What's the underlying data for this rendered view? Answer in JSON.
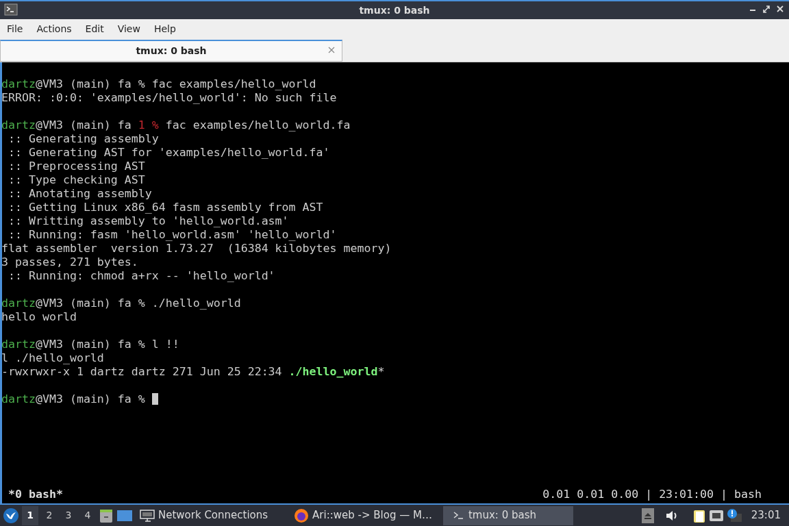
{
  "window": {
    "title": "tmux: 0 bash"
  },
  "menu": [
    "File",
    "Actions",
    "Edit",
    "View",
    "Help"
  ],
  "tabs": [
    {
      "label": "tmux: 0 bash",
      "selected": true
    }
  ],
  "terminal": {
    "blocks": [
      [
        [
          {
            "text": "dartz",
            "kind": "user"
          },
          {
            "text": "@VM3 (main) fa % fac examples/hello_world",
            "kind": "plain"
          }
        ],
        [
          {
            "text": "ERROR: :0:0: 'examples/hello_world': No such file",
            "kind": "plain"
          }
        ]
      ],
      [
        [
          {
            "text": "dartz",
            "kind": "user"
          },
          {
            "text": "@VM3 (main) fa ",
            "kind": "plain"
          },
          {
            "text": "1 %",
            "kind": "error"
          },
          {
            "text": " fac examples/hello_world.fa",
            "kind": "plain"
          }
        ],
        [
          {
            "text": " :: Generating assembly",
            "kind": "plain"
          }
        ],
        [
          {
            "text": " :: Generating AST for 'examples/hello_world.fa'",
            "kind": "plain"
          }
        ],
        [
          {
            "text": " :: Preprocessing AST",
            "kind": "plain"
          }
        ],
        [
          {
            "text": " :: Type checking AST",
            "kind": "plain"
          }
        ],
        [
          {
            "text": " :: Anotating assembly",
            "kind": "plain"
          }
        ],
        [
          {
            "text": " :: Getting Linux x86_64 fasm assembly from AST",
            "kind": "plain"
          }
        ],
        [
          {
            "text": " :: Writting assembly to 'hello_world.asm'",
            "kind": "plain"
          }
        ],
        [
          {
            "text": " :: Running: fasm 'hello_world.asm' 'hello_world'",
            "kind": "plain"
          }
        ],
        [
          {
            "text": "flat assembler  version 1.73.27  (16384 kilobytes memory)",
            "kind": "plain"
          }
        ],
        [
          {
            "text": "3 passes, 271 bytes.",
            "kind": "plain"
          }
        ],
        [
          {
            "text": " :: Running: chmod a+rx -- 'hello_world'",
            "kind": "plain"
          }
        ]
      ],
      [
        [
          {
            "text": "dartz",
            "kind": "user"
          },
          {
            "text": "@VM3 (main) fa % ./hello_world",
            "kind": "plain"
          }
        ],
        [
          {
            "text": "hello world",
            "kind": "plain"
          }
        ]
      ],
      [
        [
          {
            "text": "dartz",
            "kind": "user"
          },
          {
            "text": "@VM3 (main) fa % l !!",
            "kind": "plain"
          }
        ],
        [
          {
            "text": "l ./hello_world",
            "kind": "plain"
          }
        ],
        [
          {
            "text": "-rwxrwxr-x 1 dartz dartz 271 Jun 25 22:34 ",
            "kind": "plain"
          },
          {
            "text": "./hello_world",
            "kind": "exec"
          },
          {
            "text": "*",
            "kind": "plain"
          }
        ]
      ],
      [
        [
          {
            "text": "dartz",
            "kind": "user"
          },
          {
            "text": "@VM3 (main) fa % ",
            "kind": "plain"
          },
          {
            "kind": "cursor"
          }
        ]
      ]
    ],
    "status_left": "*0 bash*",
    "status_right": "0.01 0.01 0.00 | 23:01:00 | bash"
  },
  "taskbar": {
    "workspaces": [
      {
        "label": "1",
        "selected": true
      },
      {
        "label": "2",
        "selected": false
      },
      {
        "label": "3",
        "selected": false
      },
      {
        "label": "4",
        "selected": false
      }
    ],
    "tasks": [
      {
        "label": "Network Connections",
        "kind": "network",
        "selected": false
      },
      {
        "label": "Ari::web -> Blog — M…",
        "kind": "browser",
        "selected": false
      },
      {
        "label": "tmux: 0 bash",
        "kind": "terminal",
        "selected": true
      }
    ],
    "clock": "23:01"
  }
}
